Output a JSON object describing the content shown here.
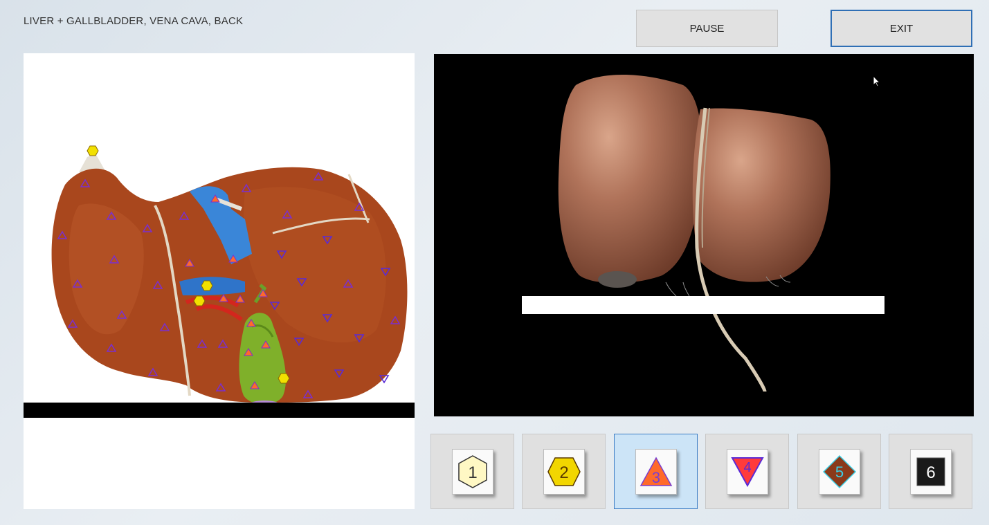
{
  "header": {
    "title": "LIVER + GALLBLADDER, VENA CAVA, BACK"
  },
  "toolbar": {
    "pause_label": "PAUSE",
    "exit_label": "EXIT"
  },
  "tiles": [
    {
      "label": "1",
      "icon": "hexagon-icon",
      "fill": "#fff8c4",
      "text_color": "#333333"
    },
    {
      "label": "2",
      "icon": "hexagon-wide-icon",
      "fill": "#f2d600",
      "text_color": "#5a3b00"
    },
    {
      "label": "3",
      "icon": "triangle-up-icon",
      "fill": "#ff6a2a",
      "text_color": "#7a3fd0"
    },
    {
      "label": "4",
      "icon": "triangle-down-icon",
      "fill": "#ff3b3b",
      "text_color": "#5a2bd6"
    },
    {
      "label": "5",
      "icon": "diamond-icon",
      "fill": "#8a3a1a",
      "text_color": "#3ad0e8"
    },
    {
      "label": "6",
      "icon": "square-icon",
      "fill": "#1a1a1a",
      "text_color": "#ffffff"
    }
  ],
  "selected_tile": 3,
  "colors": {
    "exit_border": "#2f6fb5",
    "active_tile_bg": "#cce4f7",
    "liver": "#a9471d",
    "gallbladder": "#7fb02a",
    "vena_cava": "#3a86d8"
  }
}
